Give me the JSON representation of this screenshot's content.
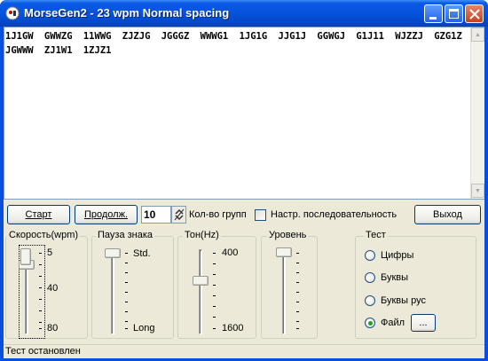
{
  "window": {
    "title": "MorseGen2 - 23 wpm Normal spacing"
  },
  "text_output": {
    "content": "1J1GW GWWZG 11WWG ZJZJG JGGGZ WWWG1 1JG1G JJG1J GGWGJ G1J11 WJZZJ GZG1Z JGWWW ZJ1W1 1ZJZ1"
  },
  "toolbar": {
    "start_label": "Старт",
    "continue_label": "Продолж.",
    "group_count_value": "10",
    "group_count_label": "Кол-во групп",
    "sequence_settings_label": "Настр. последовательность",
    "sequence_settings_checked": false,
    "exit_label": "Выход"
  },
  "speed": {
    "title": "Скорость(wpm)",
    "ticks": [
      "5",
      "40",
      "80"
    ]
  },
  "pause": {
    "title": "Пауза знака",
    "ticks": [
      "Std.",
      "Long"
    ]
  },
  "tone": {
    "title": "Тон(Hz)",
    "ticks": [
      "400",
      "1600"
    ]
  },
  "level": {
    "title": "Уровень"
  },
  "test": {
    "title": "Тест",
    "options": [
      {
        "label": "Цифры",
        "selected": false
      },
      {
        "label": "Буквы",
        "selected": false
      },
      {
        "label": "Буквы рус",
        "selected": false
      },
      {
        "label": "Файл",
        "selected": true
      }
    ],
    "browse_label": "..."
  },
  "status": {
    "text": "Тест остановлен"
  }
}
